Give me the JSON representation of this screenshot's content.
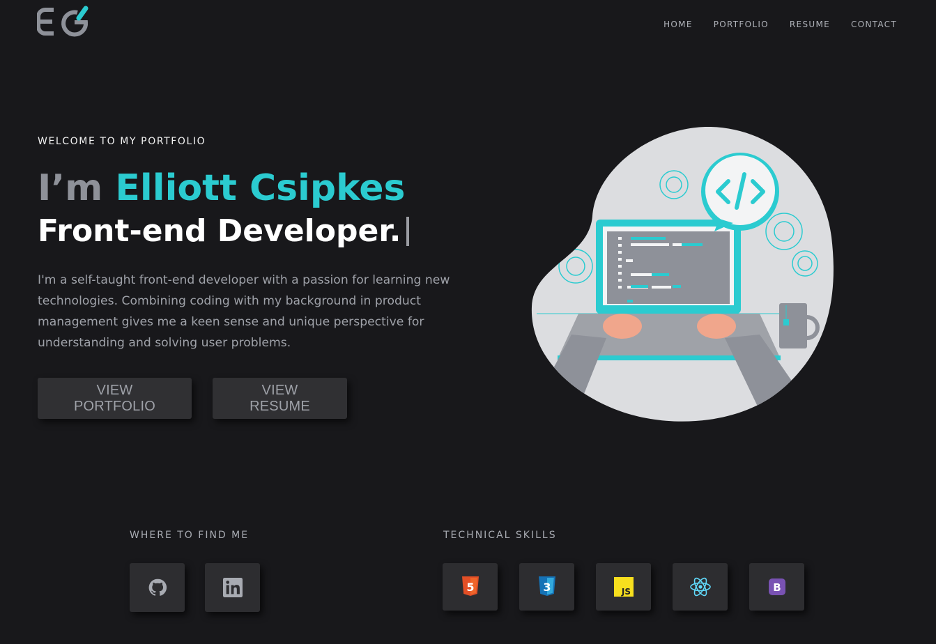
{
  "brand": {
    "logo_icon": "eg-monogram-logo",
    "accent_color": "#2bcbd0"
  },
  "nav": {
    "items": [
      "HOME",
      "PORTFOLIO",
      "RESUME",
      "CONTACT"
    ]
  },
  "hero": {
    "eyebrow": "WELCOME TO MY PORTFOLIO",
    "greeting": "I’m",
    "name": "Elliott Csipkes",
    "role": "Front-end Developer.",
    "bio": "I'm a self-taught front-end developer with a passion for learning new technologies. Combining coding with my background in product management gives me a keen sense and unique perspective for understanding and solving user problems.",
    "buttons": {
      "portfolio": "VIEW PORTFOLIO",
      "resume": "VIEW RESUME"
    },
    "illustration": "developer-laptop-illustration"
  },
  "find_me": {
    "label": "WHERE TO FIND ME",
    "links": [
      {
        "icon": "github-icon"
      },
      {
        "icon": "linkedin-icon"
      }
    ]
  },
  "skills": {
    "label": "TECHNICAL SKILLS",
    "items": [
      {
        "icon": "html5-icon",
        "color": "#e34f26",
        "glyph": "5"
      },
      {
        "icon": "css3-icon",
        "color": "#1572b6",
        "glyph": "3"
      },
      {
        "icon": "javascript-icon",
        "color": "#f7df1e",
        "glyph": "JS"
      },
      {
        "icon": "react-icon",
        "color": "#61dafb"
      },
      {
        "icon": "bootstrap-icon",
        "color": "#7952b3",
        "glyph": "B"
      }
    ]
  },
  "colors": {
    "background": "#18181b",
    "tile": "#2d2d30",
    "muted_text": "#9ea1a8"
  }
}
